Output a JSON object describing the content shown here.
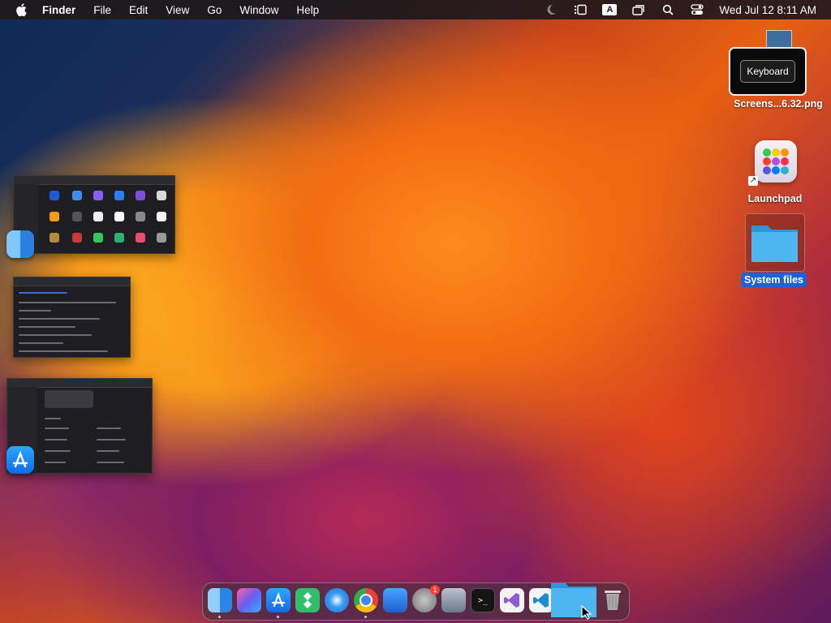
{
  "menubar": {
    "app_name": "Finder",
    "items": [
      "File",
      "Edit",
      "View",
      "Go",
      "Window",
      "Help"
    ],
    "input_source": "A",
    "clock": "Wed Jul 12  8:11 AM"
  },
  "desktop": {
    "tooltip_key": "Keyboard",
    "screenshot_label": "Screens...6.32.png",
    "launchpad_label": "Launchpad",
    "system_files_label": "System files"
  },
  "dock": {
    "apps": [
      "Finder",
      "Shortcuts",
      "App Store",
      "Craft",
      "Safari",
      "Google Chrome",
      "Xcode",
      "System Settings",
      "Automator",
      "Terminal",
      "Visual Studio",
      "Visual Studio Code",
      "Folder",
      "Trash"
    ],
    "settings_badge": "1"
  },
  "colors": {
    "selection_blue": "#1e63d6",
    "menubar_bg": "#1e181a"
  }
}
